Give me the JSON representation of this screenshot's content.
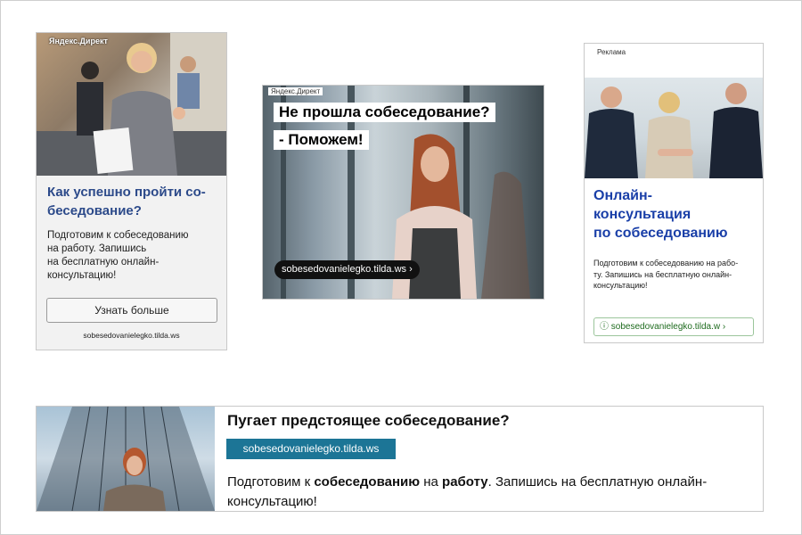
{
  "ad1": {
    "tag": "Яндекс.Директ",
    "title": "Как успешно пройти со-беседование?",
    "body": "Подготовим к собеседованию\nна работу. Запишись\nна бесплатную онлайн-\nконсультацию!",
    "button_label": "Узнать больше",
    "domain": "sobesedovanielegko.tilda.ws"
  },
  "ad2": {
    "tag": "Яндекс.Директ",
    "headline_1": "Не прошла собеседование?",
    "headline_2": "- Поможем!",
    "link_label": "sobesedovanielegko.tilda.ws ›"
  },
  "ad3": {
    "tag": "Реклама",
    "title": "Онлайн-\nконсультация\nпо собеседованию",
    "body": "Подготовим к собеседованию на рабо-\nту. Запишись на бесплатную онлайн-\nконсультацию!",
    "link_label": "ⓘ sobesedovanielegko.tilda.w ›"
  },
  "ad4": {
    "title": "Пугает предстоящее собеседование?",
    "domain": "sobesedovanielegko.tilda.ws",
    "body_part1": "Подготовим к ",
    "body_bold1": "собеседованию",
    "body_part2": " на ",
    "body_bold2": "работу",
    "body_part3": ". Запишись на бесплатную онлайн-консультацию!"
  },
  "colors": {
    "ad1_title": "#2c4a8a",
    "ad3_title": "#1a3fa8",
    "ad4_domain_bg": "#1c7596",
    "ad3_link": "#1e6b1e"
  }
}
